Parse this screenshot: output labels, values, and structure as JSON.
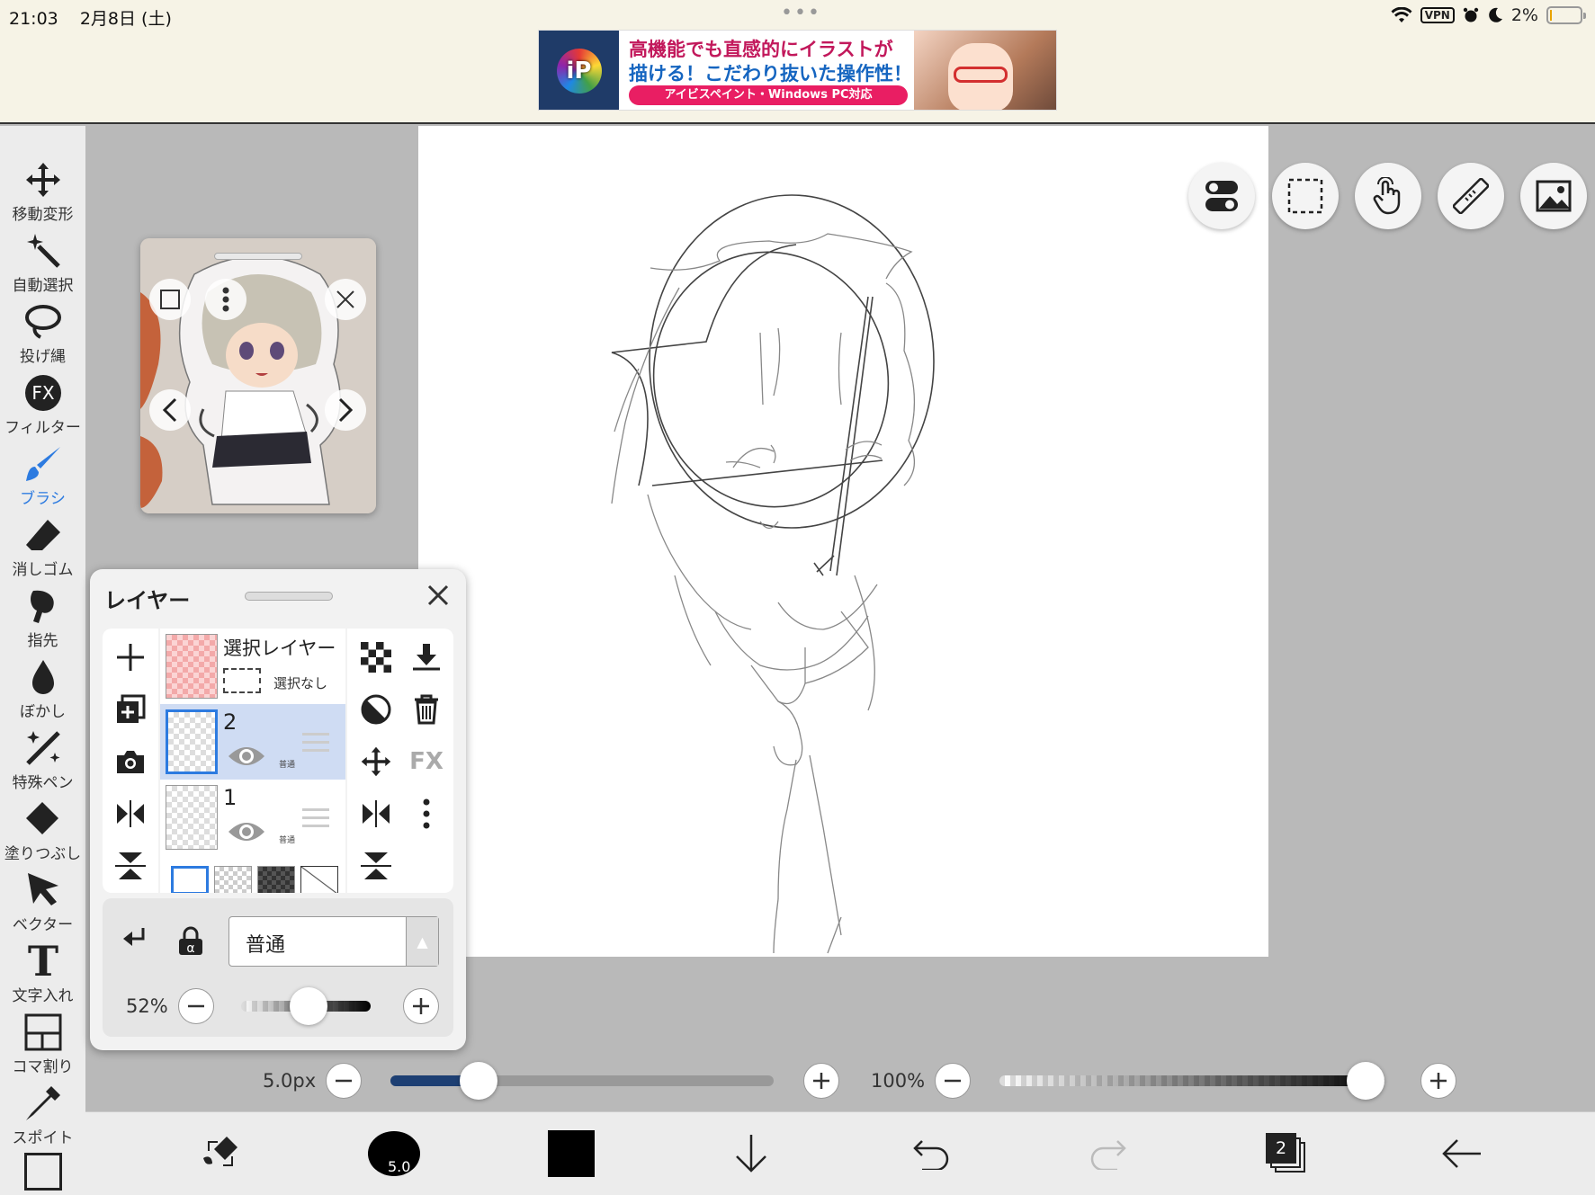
{
  "status": {
    "time": "21:03",
    "date": "2月8日 (土)",
    "dots": "•••",
    "vpn": "VPN",
    "battery": "2%"
  },
  "ad": {
    "logo_text": "iP",
    "line1": "高機能でも直感的にイラストが",
    "line2": "描ける！こだわり抜いた操作性！",
    "pill": "アイビスペイント・Windows PC対応"
  },
  "toolbar": {
    "items": [
      {
        "label": "移動変形",
        "icon": "move-icon"
      },
      {
        "label": "自動選択",
        "icon": "magic-wand-icon"
      },
      {
        "label": "投げ縄",
        "icon": "lasso-icon"
      },
      {
        "label": "フィルター",
        "icon": "fx-icon",
        "fx": "FX"
      },
      {
        "label": "ブラシ",
        "icon": "brush-icon"
      },
      {
        "label": "消しゴム",
        "icon": "eraser-icon"
      },
      {
        "label": "指先",
        "icon": "smudge-icon"
      },
      {
        "label": "ぼかし",
        "icon": "blur-icon"
      },
      {
        "label": "特殊ペン",
        "icon": "special-pen-icon"
      },
      {
        "label": "塗りつぶし",
        "icon": "fill-icon"
      },
      {
        "label": "ベクター",
        "icon": "vector-icon"
      },
      {
        "label": "文字入れ",
        "icon": "text-icon",
        "glyph": "T"
      },
      {
        "label": "コマ割り",
        "icon": "frame-divider-icon"
      },
      {
        "label": "スポイト",
        "icon": "eyedropper-icon"
      }
    ],
    "active_index": 4,
    "accent": "#2d7be0"
  },
  "layers": {
    "title": "レイヤー",
    "selection_layer": {
      "name": "選択レイヤー",
      "status": "選択なし"
    },
    "rows": [
      {
        "name": "2",
        "mode": "普通",
        "selected": true
      },
      {
        "name": "1",
        "mode": "普通",
        "selected": false
      }
    ],
    "right_fx": "FX",
    "blend_mode": "普通",
    "opacity": "52%",
    "opacity_value": 0.52
  },
  "brush_bar": {
    "size": "5.0px",
    "size_fraction": 0.23,
    "opacity": "100%",
    "opacity_fraction": 1.0
  },
  "bottom": {
    "brush_size_badge": "5.0",
    "layer_count": "2",
    "color": "#000000"
  }
}
